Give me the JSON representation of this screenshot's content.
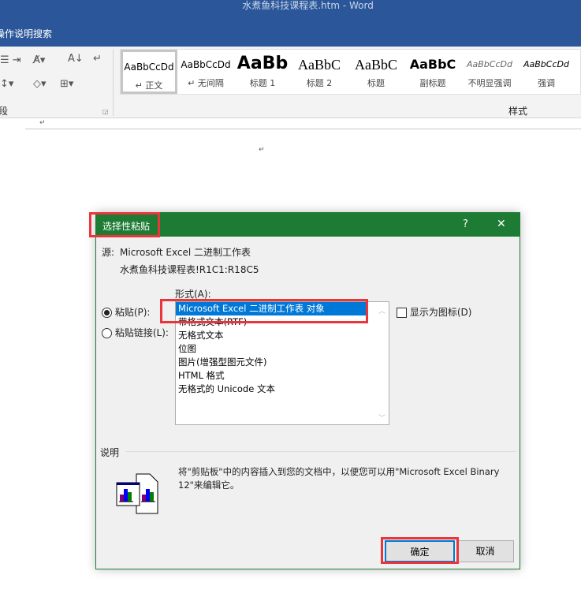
{
  "window": {
    "title": "水煮鱼科技课程表.htm  -  Word"
  },
  "tellme": {
    "label": "操作说明搜索"
  },
  "ribbon": {
    "paragraph_group_label": "段落",
    "styles_group_label": "样式",
    "styles": [
      {
        "preview": "AaBbCcDd",
        "name": "↵ 正文"
      },
      {
        "preview": "AaBbCcDd",
        "name": "↵ 无间隔"
      },
      {
        "preview": "AaBb",
        "name": "标题 1"
      },
      {
        "preview": "AaBbC",
        "name": "标题 2"
      },
      {
        "preview": "AaBbC",
        "name": "标题"
      },
      {
        "preview": "AaBbC",
        "name": "副标题"
      },
      {
        "preview": "AaBbCcDd",
        "name": "不明显强调"
      },
      {
        "preview": "AaBbCcDd",
        "name": "强调"
      }
    ]
  },
  "document": {
    "para_mark": "↵"
  },
  "dialog": {
    "title": "选择性粘贴",
    "help": "?",
    "close": "✕",
    "source_label": "源:",
    "source_value": "Microsoft Excel 二进制工作表",
    "source_range": "水煮鱼科技课程表!R1C1:R18C5",
    "format_label": "形式(A):",
    "paste_label": "粘贴(P):",
    "paste_link_label": "粘贴链接(L):",
    "formats": [
      "Microsoft Excel 二进制工作表 对象",
      "带格式文本(RTF)",
      "无格式文本",
      "位图",
      "图片(增强型图元文件)",
      "HTML 格式",
      "无格式的 Unicode 文本"
    ],
    "display_as_icon_label": "显示为图标(D)",
    "description_label": "说明",
    "description_text": "将\"剪贴板\"中的内容插入到您的文档中，以便您可以用\"Microsoft Excel Binary 12\"来编辑它。",
    "ok_label": "确定",
    "cancel_label": "取消"
  },
  "colors": {
    "word_blue": "#2b579a",
    "excel_green": "#1e7b34",
    "highlight": "#e8363b",
    "selection": "#0078d7"
  }
}
